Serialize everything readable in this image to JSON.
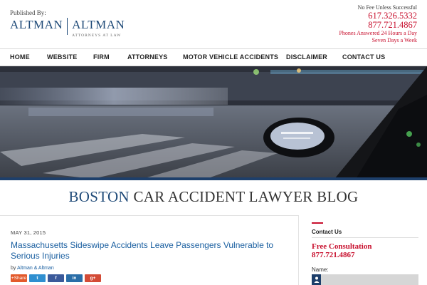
{
  "header": {
    "published_by": "Published By:",
    "logo_left": "ALTMAN",
    "logo_right": "ALTMAN",
    "logo_tagline": "ATTORNEYS AT LAW",
    "cta": "No Fee Unless Successful",
    "phone1": "617.326.5332",
    "phone2": "877.721.4867",
    "hours1": "Phones Answered 24 Hours a Day",
    "hours2": "Seven Days a Week"
  },
  "nav": {
    "items": [
      "HOME",
      "WEBSITE",
      "FIRM",
      "ATTORNEYS",
      "MOTOR VEHICLE ACCIDENTS",
      "DISCLAIMER",
      "CONTACT US"
    ]
  },
  "blog": {
    "title_city": "BOSTON",
    "title_rest": "CAR ACCIDENT LAWYER BLOG"
  },
  "post": {
    "date": "MAY 31, 2015",
    "title": "Massachusetts Sideswipe Accidents Leave Passengers Vulnerable to Serious Injuries",
    "by_prefix": "by",
    "author": "Altman & Altman",
    "share": [
      {
        "label": "+Share",
        "color": "#e35a2b",
        "icon": "share-icon"
      },
      {
        "label": "t",
        "color": "#2f8fd0",
        "icon": "twitter-icon"
      },
      {
        "label": "f",
        "color": "#3b5a9a",
        "icon": "facebook-icon"
      },
      {
        "label": "in",
        "color": "#2a6ea8",
        "icon": "linkedin-icon"
      },
      {
        "label": "g+",
        "color": "#d34b36",
        "icon": "google-plus-icon"
      }
    ]
  },
  "sidebar": {
    "heading": "Contact Us",
    "free_consult": "Free Consultation",
    "phone": "877.721.4867",
    "name_label": "Name:"
  },
  "colors": {
    "brand_blue": "#1f4a78",
    "accent_red": "#c8102e",
    "link_blue": "#1a5fa0"
  }
}
